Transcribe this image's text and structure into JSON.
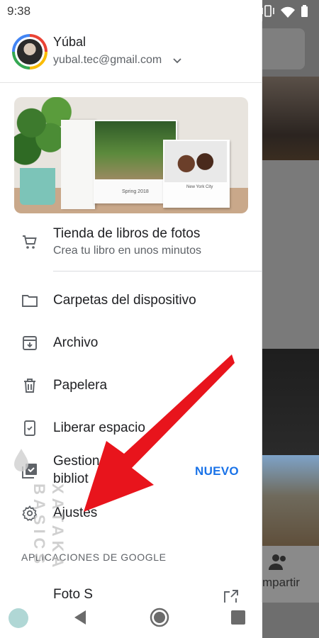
{
  "status_bar": {
    "time": "9:38"
  },
  "account": {
    "name": "Yúbal",
    "email": "yubal.tec@gmail.com"
  },
  "promo": {
    "caption_left": "Spring 2018",
    "caption_right": "New York City"
  },
  "menu": {
    "photobook": {
      "label": "Tienda de libros de fotos",
      "subtitle": "Crea tu libro en unos minutos"
    },
    "device_folders": {
      "label": "Carpetas del dispositivo"
    },
    "archive": {
      "label": "Archivo"
    },
    "trash": {
      "label": "Papelera"
    },
    "free_space": {
      "label": "Liberar espacio"
    },
    "manage_library": {
      "label": "Gestion",
      "label_line2": "bibliot",
      "badge": "NUEVO"
    },
    "settings": {
      "label": "Ajustes"
    }
  },
  "section": {
    "google_apps": "APLICACIONES DE GOOGLE"
  },
  "partial_item": {
    "label": "Foto S"
  },
  "background_app": {
    "share_label": "mpartir"
  },
  "watermark": {
    "text": "XATAKA BASICS"
  },
  "colors": {
    "arrow": "#e8141c",
    "accent": "#1a73e8"
  },
  "icons": [
    "cart-icon",
    "folder-icon",
    "archive-icon",
    "trash-icon",
    "phone-check-icon",
    "library-check-icon",
    "gear-icon",
    "external-link-icon",
    "chevron-down-icon"
  ]
}
